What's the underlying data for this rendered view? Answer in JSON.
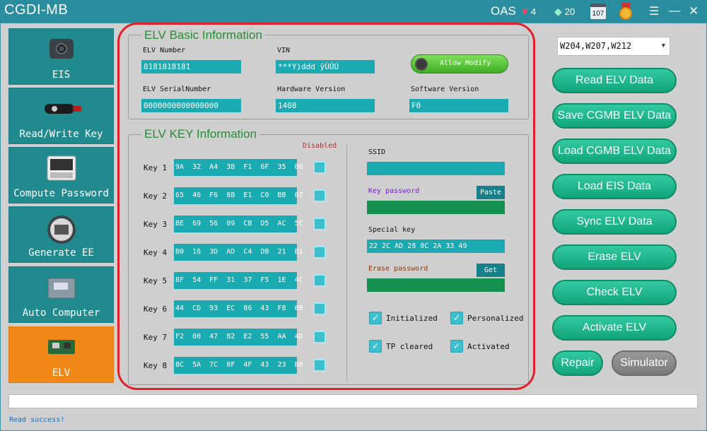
{
  "window": {
    "title": "CGDI-MB",
    "oas": "OAS",
    "heart_count": "4",
    "diamond_count": "20",
    "calendar_day": "107"
  },
  "sidebar": {
    "items": [
      {
        "label": "EIS",
        "icon": "eis-key-icon"
      },
      {
        "label": "Read/Write Key",
        "icon": "car-key-icon"
      },
      {
        "label": "Compute Password",
        "icon": "keyboard-icon"
      },
      {
        "label": "Generate EE",
        "icon": "chip-icon"
      },
      {
        "label": "Auto Computer",
        "icon": "ecu-icon"
      },
      {
        "label": "ELV",
        "icon": "elv-module-icon"
      }
    ],
    "active_index": 5
  },
  "basic_info": {
    "title": "ELV Basic Information",
    "elv_number_label": "ELV Number",
    "elv_number": "8181818181",
    "vin_label": "VIN",
    "vin": "***Y)ddd ÿÙÛÙ",
    "allow_modify": "Allow Modify",
    "serial_label": "ELV SerialNumber",
    "serial": "0000000000000000",
    "hw_label": "Hardware Version",
    "hw": "1408",
    "sw_label": "Software Version",
    "sw": "F0"
  },
  "key_info": {
    "title": "ELV KEY Information",
    "disabled_label": "Disabled",
    "keys": [
      {
        "label": "Key 1",
        "value": "9A  32  A4  3B  F1  6F  35  06"
      },
      {
        "label": "Key 2",
        "value": "65  46  F6  8B  E1  C0  BB  07"
      },
      {
        "label": "Key 3",
        "value": "BE  69  56  09  CB  D5  AC  5C"
      },
      {
        "label": "Key 4",
        "value": "B0  16  3D  AD  C4  DB  21  B1"
      },
      {
        "label": "Key 5",
        "value": "8F  54  FF  31  37  F5  1E  4C"
      },
      {
        "label": "Key 6",
        "value": "44  CD  93  EC  86  43  F8  08"
      },
      {
        "label": "Key 7",
        "value": "F2  00  47  B2  E2  55  AA  4D"
      },
      {
        "label": "Key 8",
        "value": "8C  5A  7C  8F  4F  43  23  B0"
      }
    ],
    "ssid_label": "SSID",
    "ssid": "",
    "key_password_label": "Key password",
    "key_password": "",
    "paste": "Paste",
    "special_key_label": "Special key",
    "special_key": "22  2C  AD  28  0C  2A  33  49",
    "erase_password_label": "Erase password",
    "erase_password": "",
    "get": "Get",
    "initialized": "Initialized",
    "personalized": "Personalized",
    "tp_cleared": "TP cleared",
    "activated": "Activated"
  },
  "right": {
    "model_select": "W204,W207,W212",
    "buttons": [
      "Read  ELV Data",
      "Save CGMB ELV Data",
      "Load CGMB ELV Data",
      "Load EIS Data",
      "Sync ELV Data",
      "Erase ELV",
      "Check ELV",
      "Activate ELV"
    ],
    "repair": "Repair",
    "simulator": "Simulator"
  },
  "status": "Read success!"
}
